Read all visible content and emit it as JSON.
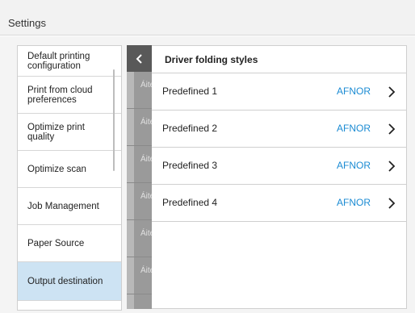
{
  "header": {
    "title": "Settings"
  },
  "sidebar": {
    "items": [
      {
        "label": "Default printing configuration"
      },
      {
        "label": "Print from cloud preferences"
      },
      {
        "label": "Optimize print quality"
      },
      {
        "label": "Optimize scan"
      },
      {
        "label": "Job Management"
      },
      {
        "label": "Paper Source"
      },
      {
        "label": "Output destination",
        "selected": true
      }
    ]
  },
  "underlying": {
    "fragments": [
      "Áite",
      "Áite",
      "Áite",
      "Áite",
      "Áite",
      "Áite"
    ]
  },
  "panel": {
    "back_icon": "chevron-left-icon",
    "title": "Driver folding styles",
    "options": [
      {
        "label": "Predefined 1",
        "value": "AFNOR"
      },
      {
        "label": "Predefined 2",
        "value": "AFNOR"
      },
      {
        "label": "Predefined 3",
        "value": "AFNOR"
      },
      {
        "label": "Predefined 4",
        "value": "AFNOR"
      }
    ]
  },
  "colors": {
    "accent": "#1b8bd3",
    "selected_bg": "#cde3f3",
    "back_button_bg": "#595959"
  }
}
